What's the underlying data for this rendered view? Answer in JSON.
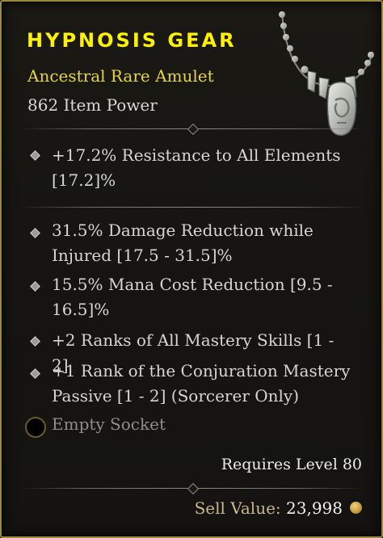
{
  "item": {
    "name": "HYPNOSIS GEAR",
    "type": "Ancestral Rare Amulet",
    "item_power": "862 Item Power"
  },
  "affixes": {
    "implicit": [
      {
        "lines": [
          "+17.2% Resistance to All Elements",
          "[17.2]%"
        ]
      }
    ],
    "explicit": [
      {
        "lines": [
          "31.5% Damage Reduction while",
          "Injured [17.5 - 31.5]%"
        ]
      },
      {
        "lines": [
          "15.5% Mana Cost Reduction [9.5 -",
          "16.5]%"
        ]
      },
      {
        "lines": [
          "+2 Ranks of All Mastery Skills [1 - 2]"
        ]
      },
      {
        "lines": [
          "+1 Rank of the Conjuration Mastery",
          "Passive [1 - 2] (Sorcerer Only)"
        ]
      }
    ]
  },
  "socket": {
    "label": "Empty Socket"
  },
  "requirement": "Requires Level 80",
  "sell": {
    "label": "Sell Value:",
    "value": "23,998"
  },
  "icons": {
    "item_image": "amulet-icon",
    "socket": "empty-socket-icon",
    "currency": "gold-coin-icon",
    "bullet": "diamond-bullet-icon"
  },
  "colors": {
    "border": "#9b8a3e",
    "title": "#fff200",
    "rarity": "#e9d53a",
    "text": "#d6d6d6",
    "muted": "#8d8d8d"
  }
}
